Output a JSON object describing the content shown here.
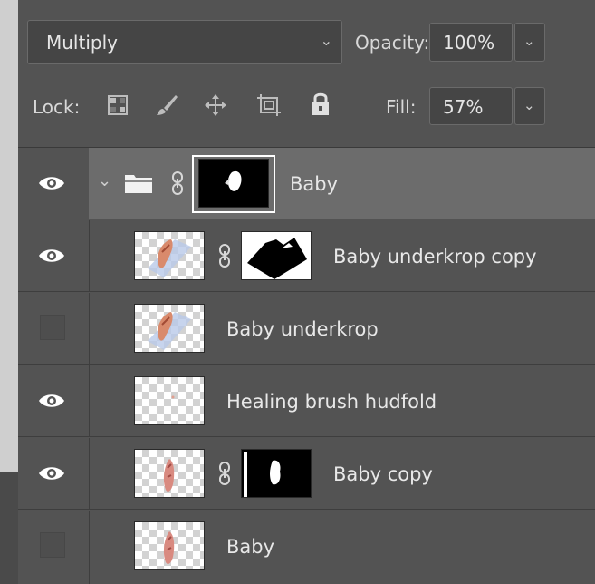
{
  "blend": {
    "mode": "Multiply",
    "opacity_label": "Opacity:",
    "opacity_value": "100%"
  },
  "lock": {
    "label": "Lock:",
    "fill_label": "Fill:",
    "fill_value": "57%"
  },
  "layers": [
    {
      "name": "Baby",
      "visible": true,
      "kind": "group",
      "selected": true
    },
    {
      "name": "Baby underkrop copy",
      "visible": true
    },
    {
      "name": "Baby underkrop",
      "visible": false
    },
    {
      "name": "Healing brush hudfold",
      "visible": true
    },
    {
      "name": "Baby copy",
      "visible": true
    },
    {
      "name": "Baby",
      "visible": false
    }
  ]
}
